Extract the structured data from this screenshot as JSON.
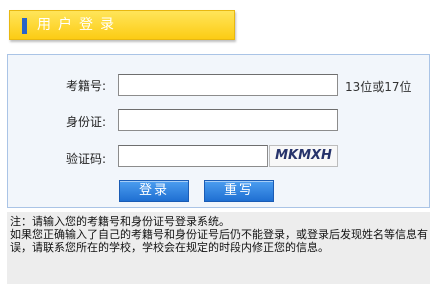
{
  "header": {
    "title": "用户登录"
  },
  "form": {
    "exam_id_label": "考籍号:",
    "exam_id_value": "",
    "exam_id_hint": "13位或17位",
    "id_card_label": "身份证:",
    "id_card_value": "",
    "captcha_label": "验证码:",
    "captcha_value": "",
    "captcha_image_text": "MKMXH",
    "login_button": "登录",
    "rewrite_button": "重写"
  },
  "note": {
    "line1": "注：请输入您的考籍号和身份证号登录系统。",
    "line2": "如果您正确输入了自己的考籍号和身份证号后仍不能登录，或登录后发现姓名等信息有误，请联系您所在的学校，学校会在规定的时段内修正您的信息。"
  },
  "colors": {
    "header_bg": "#fcd42a",
    "header_bar": "#2a64c8",
    "form_bg": "#f2f6fb",
    "form_border": "#aac4e6",
    "button_bg": "#2f82e0",
    "note_bg": "#ededed"
  }
}
